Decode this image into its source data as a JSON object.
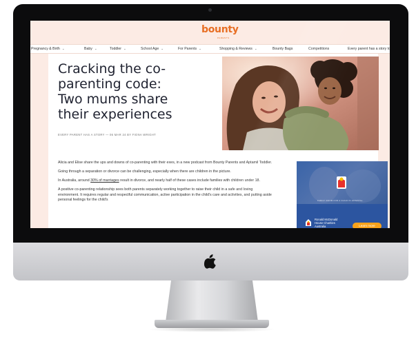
{
  "site": {
    "logo": "bounty",
    "logo_tagline": "PARENTS"
  },
  "nav": {
    "items": [
      {
        "label": "Pregnancy & Birth",
        "chevron": true
      },
      {
        "label": "Baby",
        "chevron": true
      },
      {
        "label": "Toddler",
        "chevron": true
      },
      {
        "label": "School Age",
        "chevron": true
      },
      {
        "label": "For Parents",
        "chevron": true
      },
      {
        "label": "Shopping & Reviews",
        "chevron": true
      },
      {
        "label": "Bounty Bags",
        "chevron": false
      },
      {
        "label": "Competitions",
        "chevron": false
      },
      {
        "label": "Every parent has a story to tell",
        "chevron": false
      }
    ],
    "chevron_glyph": "⌄"
  },
  "article": {
    "title": "Cracking the co-parenting code: Two mums share their experiences",
    "byline": "EVERY PARENT HAS A STORY — 06 MAR 24 BY FIONA WRIGHT",
    "paragraphs": [
      "Alicia and Elise share the ups and downs of co-parenting with their exes, in a new podcast from Bounty Parents and Aptamil Toddler.",
      "Going through a separation or divorce can be challenging, especially when there are children in the picture."
    ],
    "p3_before": "In Australia, around ",
    "p3_link": "30% of marriages",
    "p3_after": " result in divorce, and nearly half of these cases include families with children under 18.",
    "p4": "A positive co-parenting relationship sees both parents separately working together to raise their child in a safe and loving environment. It requires regular and respectful communication, active participation in the child's care and activities, and putting aside personal feelings for the child's"
  },
  "ad": {
    "caption": "FAMILY ROOM FOR A CHILD IN HOSPITAL",
    "brand": "Ronald McDonald House Charities Australia",
    "cta": "Learn more"
  },
  "colors": {
    "brand_orange": "#e86f24",
    "page_bg": "#fcebe4",
    "ad_blue": "#2c55a0",
    "cta_orange": "#f7a21b"
  }
}
